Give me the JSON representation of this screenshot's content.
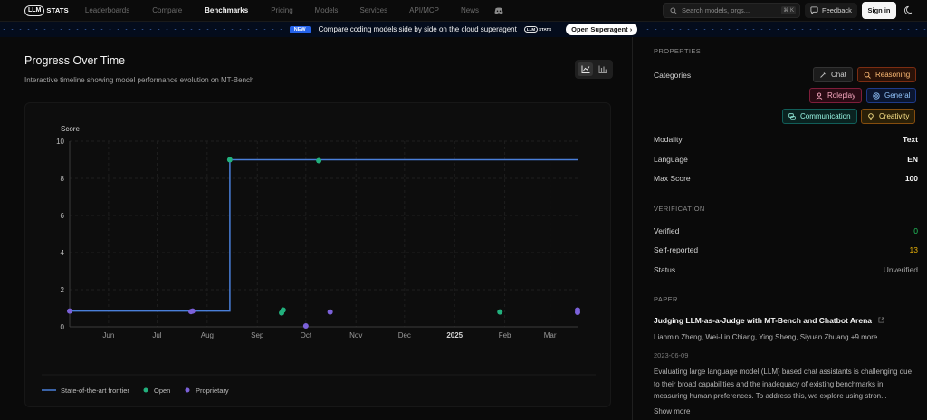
{
  "nav": {
    "logo_pill": "LLM",
    "logo_text": "STATS",
    "links": [
      {
        "label": "Leaderboards",
        "active": false
      },
      {
        "label": "Compare",
        "active": false
      },
      {
        "label": "Benchmarks",
        "active": true
      },
      {
        "label": "Pricing",
        "active": false
      },
      {
        "label": "Models",
        "active": false
      },
      {
        "label": "Services",
        "active": false
      },
      {
        "label": "API/MCP",
        "active": false
      },
      {
        "label": "News",
        "active": false
      }
    ],
    "search_placeholder": "Search models, orgs...",
    "search_shortcut": "⌘ K",
    "feedback_label": "Feedback",
    "signin_label": "Sign in"
  },
  "banner": {
    "badge": "NEW",
    "text": "Compare coding models side by side on the cloud superagent",
    "logo_pill": "LLM",
    "logo_text": "STATS",
    "button_label": "Open Superagent ›"
  },
  "main": {
    "title": "Progress Over Time",
    "subtitle": "Interactive timeline showing model performance evolution on MT-Bench"
  },
  "chart_data": {
    "type": "line",
    "ylabel": "Score",
    "ylim": [
      0,
      10
    ],
    "yticks": [
      0,
      2,
      4,
      6,
      8,
      10
    ],
    "x_ticks": [
      {
        "label": "Jun",
        "date": "2024-06-01",
        "bold": false
      },
      {
        "label": "Jul",
        "date": "2024-07-01",
        "bold": false
      },
      {
        "label": "Aug",
        "date": "2024-08-01",
        "bold": false
      },
      {
        "label": "Sep",
        "date": "2024-09-01",
        "bold": false
      },
      {
        "label": "Oct",
        "date": "2024-10-01",
        "bold": false
      },
      {
        "label": "Nov",
        "date": "2024-11-01",
        "bold": false
      },
      {
        "label": "Dec",
        "date": "2024-12-01",
        "bold": false
      },
      {
        "label": "2025",
        "date": "2025-01-01",
        "bold": true
      },
      {
        "label": "Feb",
        "date": "2025-02-01",
        "bold": false
      },
      {
        "label": "Mar",
        "date": "2025-03-01",
        "bold": false
      }
    ],
    "xlim": [
      "2024-05-08",
      "2025-03-18"
    ],
    "frontier": [
      {
        "date": "2024-05-08",
        "y": 0.85
      },
      {
        "date": "2024-08-15",
        "y": 0.85
      },
      {
        "date": "2024-08-15",
        "y": 9.0
      },
      {
        "date": "2025-03-18",
        "y": 9.0
      }
    ],
    "series": [
      {
        "name": "Open",
        "color": "#22b07d",
        "points": [
          {
            "date": "2024-08-15",
            "y": 9.0
          },
          {
            "date": "2024-09-16",
            "y": 0.75
          },
          {
            "date": "2024-09-17",
            "y": 0.9
          },
          {
            "date": "2024-10-09",
            "y": 8.95
          },
          {
            "date": "2025-01-29",
            "y": 0.8
          }
        ]
      },
      {
        "name": "Proprietary",
        "color": "#7b61d9",
        "points": [
          {
            "date": "2024-05-08",
            "y": 0.85
          },
          {
            "date": "2024-07-22",
            "y": 0.82
          },
          {
            "date": "2024-07-23",
            "y": 0.85
          },
          {
            "date": "2024-10-01",
            "y": 0.05
          },
          {
            "date": "2024-10-16",
            "y": 0.8
          },
          {
            "date": "2025-03-18",
            "y": 0.78
          },
          {
            "date": "2025-03-18",
            "y": 0.9
          }
        ]
      }
    ],
    "legend": [
      {
        "label": "State-of-the-art frontier",
        "kind": "line",
        "color": "#4a7fd9"
      },
      {
        "label": "Open",
        "kind": "dot",
        "color": "#22b07d"
      },
      {
        "label": "Proprietary",
        "kind": "dot",
        "color": "#7b61d9"
      }
    ],
    "legend_position": "bottom-left",
    "grid": true
  },
  "properties": {
    "heading": "PROPERTIES",
    "categories_label": "Categories",
    "categories": {
      "chat": "Chat",
      "reasoning": "Reasoning",
      "roleplay": "Roleplay",
      "general": "General",
      "communication": "Communication",
      "creativity": "Creativity"
    },
    "modality_label": "Modality",
    "modality": "Text",
    "language_label": "Language",
    "language": "EN",
    "max_score_label": "Max Score",
    "max_score": "100"
  },
  "verification": {
    "heading": "VERIFICATION",
    "verified_label": "Verified",
    "verified": "0",
    "verified_color": "#22c55e",
    "self_reported_label": "Self-reported",
    "self_reported": "13",
    "self_reported_color": "#eab308",
    "status_label": "Status",
    "status": "Unverified"
  },
  "paper": {
    "heading": "PAPER",
    "title": "Judging LLM-as-a-Judge with MT-Bench and Chatbot Arena",
    "authors": "Lianmin Zheng, Wei-Lin Chiang, Ying Sheng, Siyuan Zhuang +9 more",
    "date": "2023-06-09",
    "abstract": "Evaluating large language model (LLM) based chat assistants is challenging due to their broad capabilities and the inadequacy of existing benchmarks in measuring human preferences. To address this, we explore using stron...",
    "show_more": "Show more"
  }
}
